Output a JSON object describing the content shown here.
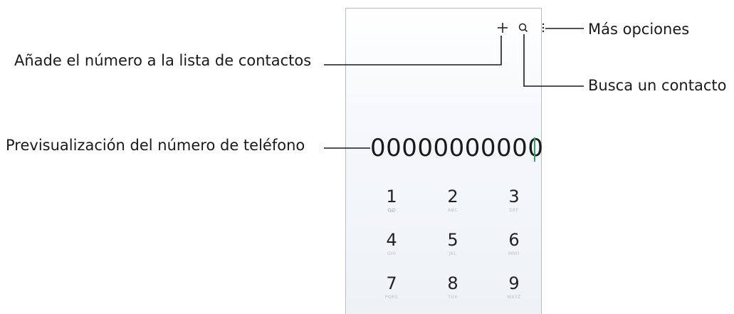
{
  "callouts": {
    "more_options": "Más opciones",
    "add_to_contacts": "Añade el número a la lista de contactos",
    "search_contact": "Busca un contacto",
    "number_preview": "Previsualización del número de teléfono"
  },
  "dialer": {
    "number": "00000000000",
    "keys": [
      {
        "digit": "1",
        "letters": "QO"
      },
      {
        "digit": "2",
        "letters": "ABC"
      },
      {
        "digit": "3",
        "letters": "DEF"
      },
      {
        "digit": "4",
        "letters": "GHI"
      },
      {
        "digit": "5",
        "letters": "JKL"
      },
      {
        "digit": "6",
        "letters": "MNO"
      },
      {
        "digit": "7",
        "letters": "PQRS"
      },
      {
        "digit": "8",
        "letters": "TUV"
      },
      {
        "digit": "9",
        "letters": "WXYZ"
      }
    ]
  },
  "icons": {
    "add": "plus-icon",
    "search": "search-icon",
    "more": "more-vertical-icon"
  },
  "colors": {
    "caret": "#2fa36b",
    "frame": "#b9bcc0",
    "leader_lines": "#1a1a1a"
  }
}
